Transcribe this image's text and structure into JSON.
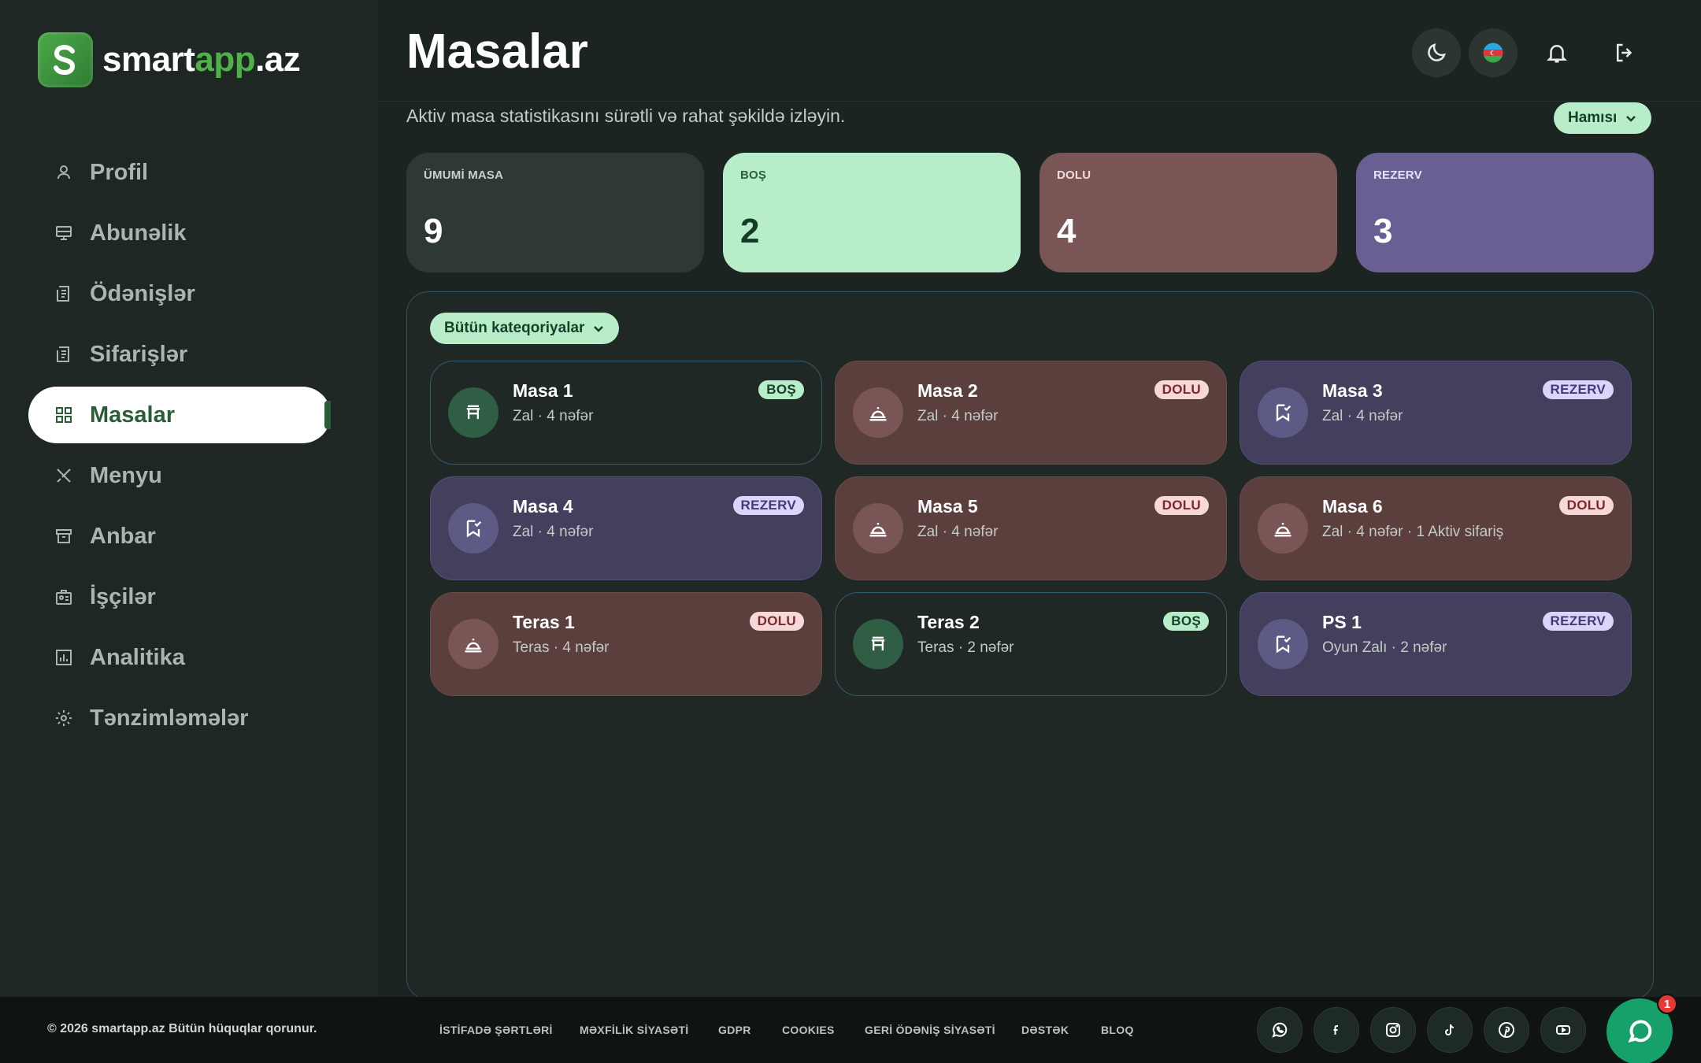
{
  "brand": {
    "name_white": "smart",
    "name_green": "app",
    "name_suffix": ".az"
  },
  "page": {
    "title": "Masalar",
    "subtitle": "Aktiv masa statistikasını sürətli və rahat şəkildə izləyin.",
    "filter_label": "Hamısı",
    "category_label": "Bütün kateqoriyalar"
  },
  "sidebar": {
    "items": [
      {
        "label": "Profil",
        "icon": "user-icon"
      },
      {
        "label": "Abunəlik",
        "icon": "monitor-icon"
      },
      {
        "label": "Ödənişlər",
        "icon": "receipt-icon"
      },
      {
        "label": "Sifarişlər",
        "icon": "receipt-icon"
      },
      {
        "label": "Masalar",
        "icon": "grid-icon",
        "active": true
      },
      {
        "label": "Menyu",
        "icon": "utensils-icon"
      },
      {
        "label": "Anbar",
        "icon": "archive-icon"
      },
      {
        "label": "İşçilər",
        "icon": "id-card-icon"
      },
      {
        "label": "Analitika",
        "icon": "chart-icon"
      },
      {
        "label": "Tənzimləmələr",
        "icon": "gear-icon"
      }
    ]
  },
  "stats": [
    {
      "label": "ÜMUMİ MASA",
      "value": "9"
    },
    {
      "label": "BOŞ",
      "value": "2"
    },
    {
      "label": "DOLU",
      "value": "4"
    },
    {
      "label": "REZERV",
      "value": "3"
    }
  ],
  "tables": [
    {
      "name": "Masa 1",
      "meta": "Zal · 4 nəfər",
      "status": "BOŞ",
      "kind": "bos"
    },
    {
      "name": "Masa 2",
      "meta": "Zal · 4 nəfər",
      "status": "DOLU",
      "kind": "dolu"
    },
    {
      "name": "Masa 3",
      "meta": "Zal · 4 nəfər",
      "status": "REZERV",
      "kind": "rez"
    },
    {
      "name": "Masa 4",
      "meta": "Zal · 4 nəfər",
      "status": "REZERV",
      "kind": "rez"
    },
    {
      "name": "Masa 5",
      "meta": "Zal · 4 nəfər",
      "status": "DOLU",
      "kind": "dolu"
    },
    {
      "name": "Masa 6",
      "meta": "Zal · 4 nəfər · 1 Aktiv sifariş",
      "status": "DOLU",
      "kind": "dolu"
    },
    {
      "name": "Teras 1",
      "meta": "Teras · 4 nəfər",
      "status": "DOLU",
      "kind": "dolu"
    },
    {
      "name": "Teras 2",
      "meta": "Teras · 2 nəfər",
      "status": "BOŞ",
      "kind": "bos"
    },
    {
      "name": "PS 1",
      "meta": "Oyun Zalı · 2 nəfər",
      "status": "REZERV",
      "kind": "rez"
    }
  ],
  "footer": {
    "copyright": "© 2026 smartapp.az Bütün hüquqlar qorunur.",
    "links": [
      "İSTİFADƏ ŞƏRTLƏRİ",
      "MƏXFİLİK SİYASƏTİ",
      "GDPR",
      "COOKIES",
      "GERİ ÖDƏNİŞ SİYASƏTİ",
      "DƏSTƏK",
      "BLOQ"
    ],
    "chat_count": "1"
  },
  "colors": {
    "accent_green": "#4fb248",
    "bos": "#b8edc9",
    "dolu": "#7a5555",
    "rezerv": "#6a5f92"
  }
}
